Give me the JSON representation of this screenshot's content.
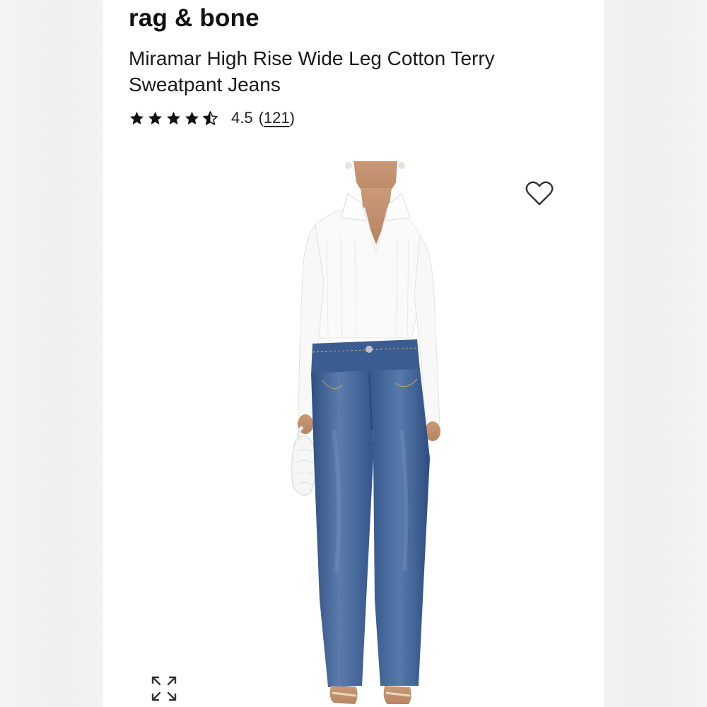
{
  "brand": "rag & bone",
  "product": {
    "title": "Miramar High Rise Wide Leg Cotton Terry Sweatpant Jeans"
  },
  "rating": {
    "stars": 4.5,
    "value": "4.5",
    "count": "121",
    "star_icon": "star-icon",
    "half_star_icon": "star-half-icon"
  },
  "icons": {
    "wishlist": "heart-outline-icon",
    "expand": "expand-arrows-icon"
  },
  "colors": {
    "text": "#111111",
    "denim": "#3d5f92",
    "background": "#ffffff"
  }
}
